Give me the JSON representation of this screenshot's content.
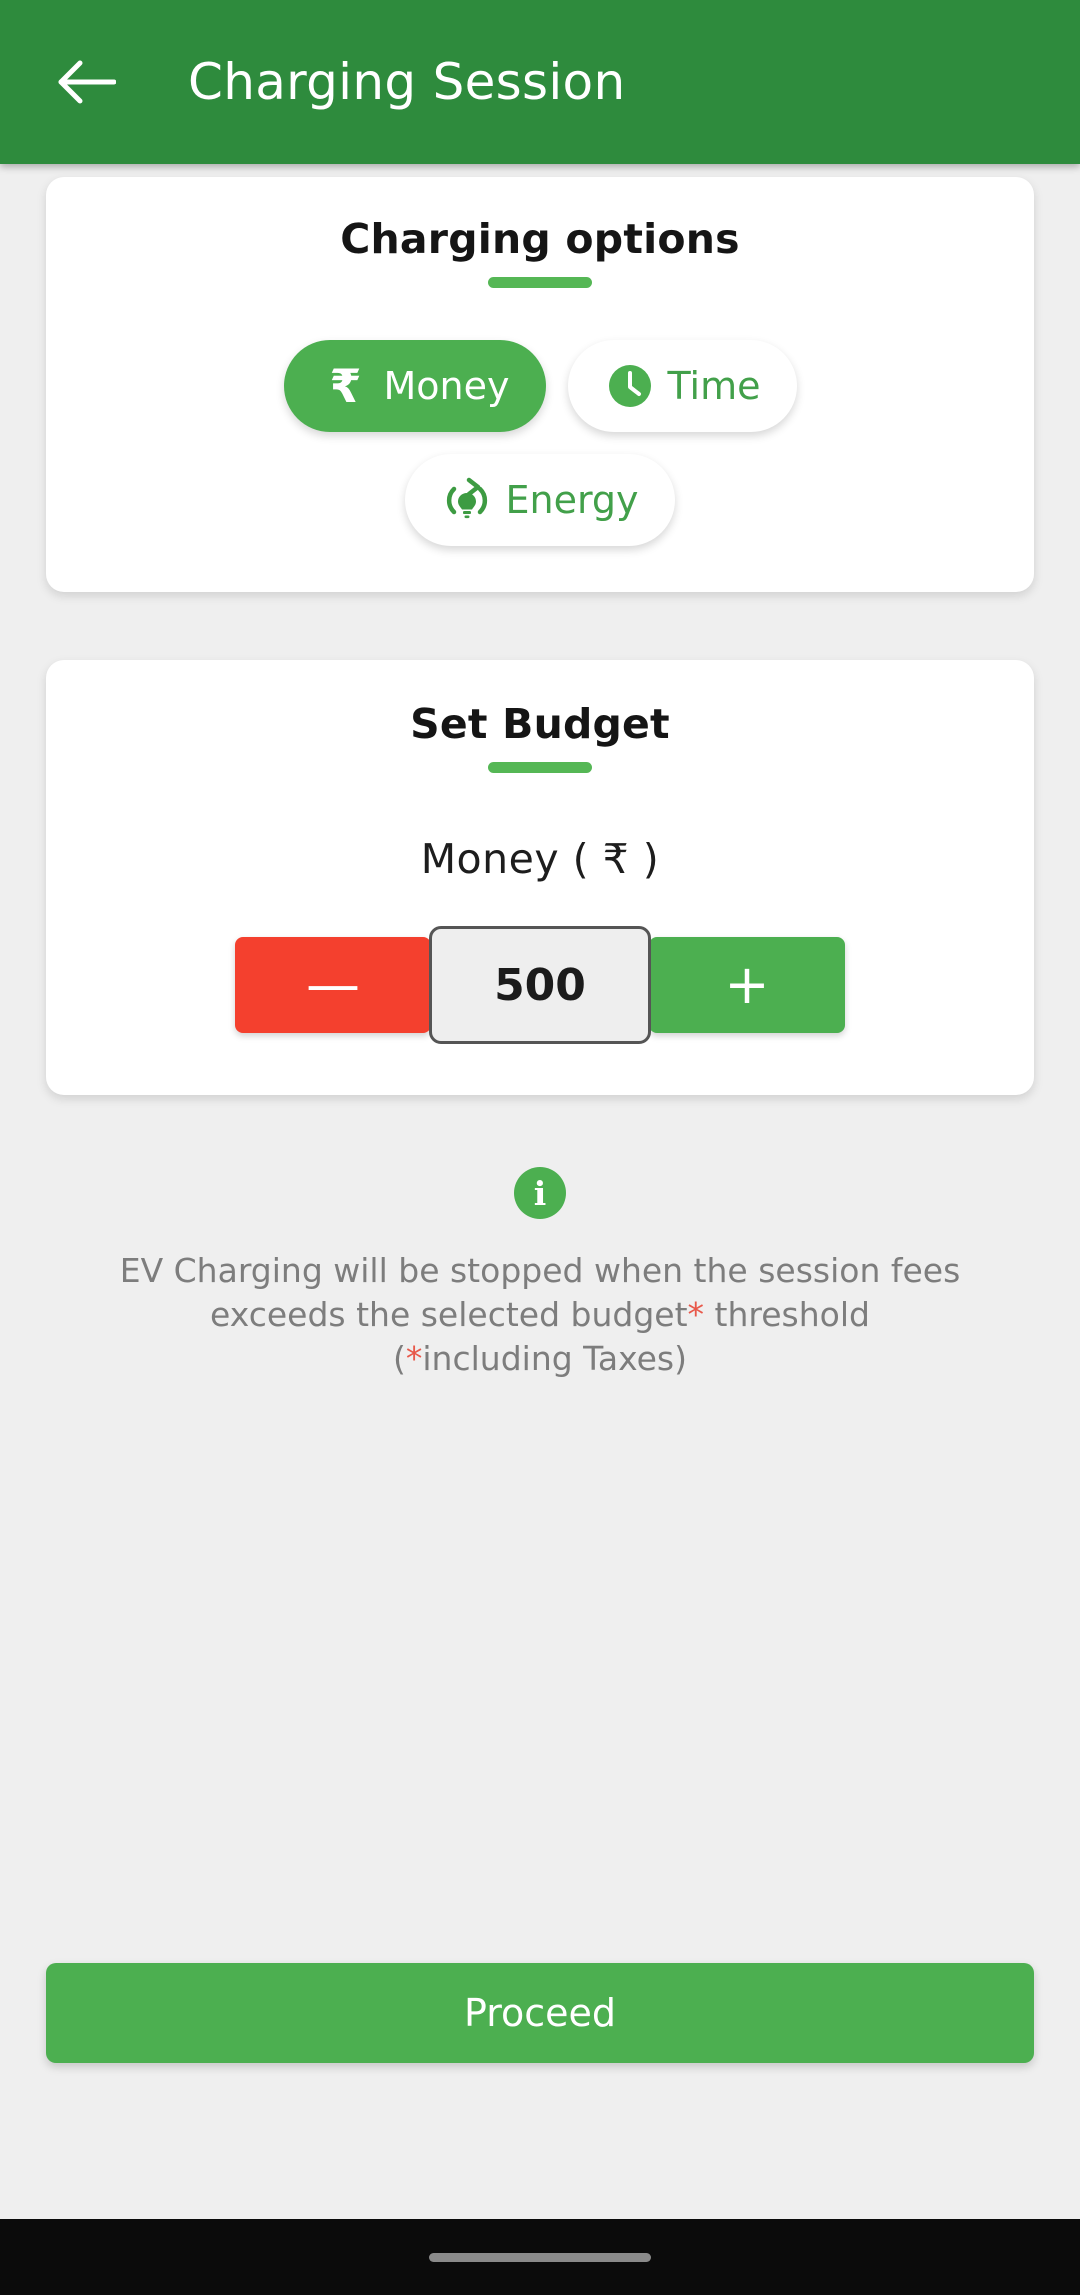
{
  "appbar": {
    "back_icon": "arrow-left-icon",
    "title": "Charging Session",
    "bg_color": "#2E8B3D"
  },
  "charging_options": {
    "card_title": "Charging options",
    "options": [
      {
        "label": "Money",
        "icon": "rupee-icon",
        "selected": true
      },
      {
        "label": "Time",
        "icon": "clock-icon",
        "selected": false
      },
      {
        "label": "Energy",
        "icon": "energy-bulb-icon",
        "selected": false
      }
    ]
  },
  "set_budget": {
    "card_title": "Set Budget",
    "unit_label": "Money ( ₹ )",
    "decrement_label": "—",
    "value": "500",
    "increment_label": "+",
    "decrement_color": "#F4402E",
    "increment_color": "#4CAF50"
  },
  "info": {
    "icon": "info-circle-icon",
    "line1_a": "EV Charging will be stopped when the session fees",
    "line2_a": "exceeds the selected budget",
    "line2_ast": "*",
    "line2_b": " threshold",
    "line3_open": "(",
    "line3_ast": "*",
    "line3_b": "including Taxes)"
  },
  "footer": {
    "proceed_label": "Proceed",
    "accent_color": "#4CAF50"
  }
}
